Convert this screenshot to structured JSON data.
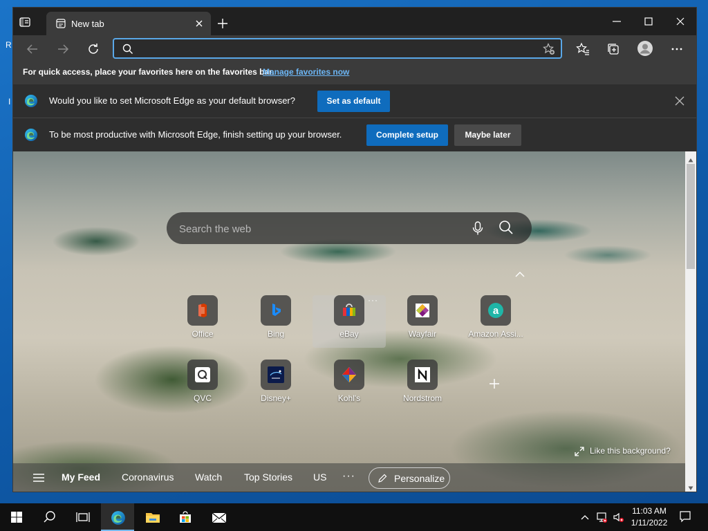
{
  "desktop": {
    "frag1": "R",
    "frag2": "I"
  },
  "browser": {
    "tab_title": "New tab",
    "address": {
      "value": "",
      "placeholder": ""
    },
    "favorites_bar": {
      "text": "For quick access, place your favorites here on the favorites bar.",
      "link": "Manage favorites now"
    }
  },
  "infobars": {
    "default_browser": {
      "text": "Would you like to set Microsoft Edge as your default browser?",
      "button": "Set as default"
    },
    "setup": {
      "text": "To be most productive with Microsoft Edge, finish setting up your browser.",
      "primary_button": "Complete setup",
      "secondary_button": "Maybe later"
    }
  },
  "newtab": {
    "search_placeholder": "Search the web",
    "tiles": [
      {
        "label": "Office",
        "icon": "office-icon"
      },
      {
        "label": "Bing",
        "icon": "bing-icon"
      },
      {
        "label": "eBay",
        "icon": "ebay-icon"
      },
      {
        "label": "Wayfair",
        "icon": "wayfair-icon"
      },
      {
        "label": "Amazon Assi...",
        "icon": "amazon-assistant-icon"
      },
      {
        "label": "QVC",
        "icon": "qvc-icon"
      },
      {
        "label": "Disney+",
        "icon": "disney-plus-icon"
      },
      {
        "label": "Kohl's",
        "icon": "kohls-icon"
      },
      {
        "label": "Nordstrom",
        "icon": "nordstrom-icon"
      }
    ],
    "tile_more": "···",
    "like_background": "Like this background?",
    "feed": {
      "items": [
        "My Feed",
        "Coronavirus",
        "Watch",
        "Top Stories",
        "US"
      ],
      "more": "···",
      "personalize": "Personalize"
    }
  },
  "taskbar": {
    "time": "11:03 AM",
    "date": "1/11/2022",
    "apps": [
      "start-icon",
      "search-icon",
      "task-view-icon",
      "edge-icon",
      "file-explorer-icon",
      "store-icon",
      "mail-icon"
    ]
  },
  "colors": {
    "accent": "#0f6cbd",
    "link": "#6cb6f5",
    "titlebar": "#202020",
    "toolbar": "#3b3b3b",
    "infobar": "#2e2e2e"
  }
}
